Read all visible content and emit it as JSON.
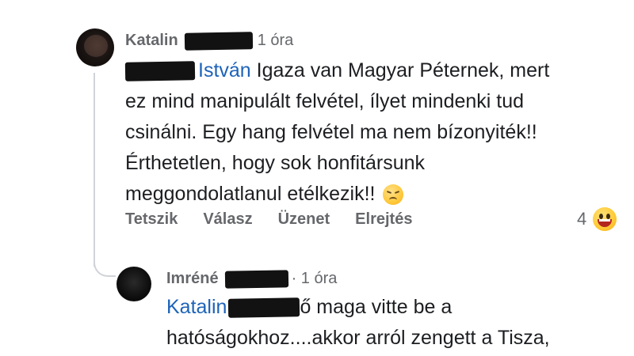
{
  "comments": [
    {
      "author": "Katalin",
      "time": "1 óra",
      "mention": "István",
      "lines": [
        "Igaza van Magyar Péternek, mert",
        "ez mind manipulált felvétel, ílyet mindenki tud",
        "csinálni. Egy hang felvétel ma nem bízonyiték!!",
        "Érthetetlen, hogy sok honfitársunk",
        "meggondolatlanul etélkezik!!"
      ],
      "emoji": "sad-face-emoji",
      "actions": [
        "Tetszik",
        "Válasz",
        "Üzenet",
        "Elrejtés"
      ],
      "reaction_count": "4",
      "reaction_emoji": "grinning-face-emoji"
    },
    {
      "author": "Imréné",
      "time": "· 1 óra",
      "mention": "Katalin",
      "lines": [
        "ő maga vitte be a",
        "hatóságokhoz....akkor arról zengett a Tisza,"
      ]
    }
  ],
  "colors": {
    "mention": "#1d63b8",
    "meta": "#65676b",
    "text": "#1c1e21",
    "thread_line": "#d0d3d8"
  }
}
